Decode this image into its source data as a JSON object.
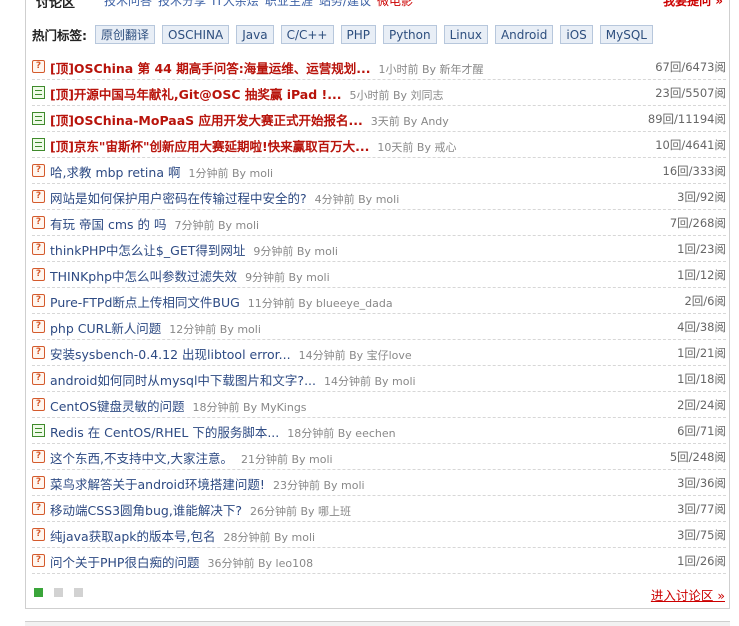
{
  "header": {
    "title": "讨论区",
    "nav": [
      "技术问答",
      "技术分享",
      "IT大杂烩",
      "职业生涯",
      "站务/建议",
      "微电影"
    ],
    "ask_label": "我要提问 »"
  },
  "tags": {
    "label": "热门标签:",
    "items": [
      "原创翻译",
      "OSCHINA",
      "Java",
      "C/C++",
      "PHP",
      "Python",
      "Linux",
      "Android",
      "iOS",
      "MySQL"
    ]
  },
  "posts": [
    {
      "icon": "question-icon",
      "title": "[顶]OSChina 第 44 期高手问答:海量运维、运营规划...",
      "meta": "1小时前 By 新年才醒",
      "count": "67回/6473阅",
      "top": true
    },
    {
      "icon": "document-icon",
      "title": "[顶]开源中国马年献礼,Git@OSC 抽奖赢 iPad !...",
      "meta": "5小时前 By 刘同志",
      "count": "23回/5507阅",
      "top": true
    },
    {
      "icon": "document-icon",
      "title": "[顶]OSChina-MoPaaS 应用开发大赛正式开始报名...",
      "meta": "3天前 By Andy",
      "count": "89回/11194阅",
      "top": true
    },
    {
      "icon": "document-icon",
      "title": "[顶]京东\"宙斯杯\"创新应用大赛延期啦!快来赢取百万大...",
      "meta": "10天前 By 戒心",
      "count": "10回/4641阅",
      "top": true
    },
    {
      "icon": "question-icon",
      "title": "哈,求教 mbp retina 啊",
      "meta": "1分钟前 By moli",
      "count": "16回/333阅",
      "top": false
    },
    {
      "icon": "question-icon",
      "title": "网站是如何保护用户密码在传输过程中安全的?",
      "meta": "4分钟前 By moli",
      "count": "3回/92阅",
      "top": false
    },
    {
      "icon": "question-icon",
      "title": "有玩 帝国 cms 的 吗",
      "meta": "7分钟前 By moli",
      "count": "7回/268阅",
      "top": false
    },
    {
      "icon": "question-icon",
      "title": "thinkPHP中怎么让$_GET得到网址",
      "meta": "9分钟前 By moli",
      "count": "1回/23阅",
      "top": false
    },
    {
      "icon": "question-icon",
      "title": "THINKphp中怎么叫参数过滤失效",
      "meta": "9分钟前 By moli",
      "count": "1回/12阅",
      "top": false
    },
    {
      "icon": "question-icon",
      "title": "Pure-FTPd断点上传相同文件BUG",
      "meta": "11分钟前 By blueeye_dada",
      "count": "2回/6阅",
      "top": false
    },
    {
      "icon": "question-icon",
      "title": "php CURL新人问题",
      "meta": "12分钟前 By moli",
      "count": "4回/38阅",
      "top": false
    },
    {
      "icon": "question-icon",
      "title": "安装sysbench-0.4.12 出现libtool error...",
      "meta": "14分钟前 By 宝仔love",
      "count": "1回/21阅",
      "top": false
    },
    {
      "icon": "question-icon",
      "title": "android如何同时从mysql中下载图片和文字?...",
      "meta": "14分钟前 By moli",
      "count": "1回/18阅",
      "top": false
    },
    {
      "icon": "question-icon",
      "title": "CentOS键盘灵敏的问题",
      "meta": "18分钟前 By MyKings",
      "count": "2回/24阅",
      "top": false
    },
    {
      "icon": "document-icon",
      "title": "Redis 在 CentOS/RHEL 下的服务脚本...",
      "meta": "18分钟前 By eechen",
      "count": "6回/71阅",
      "top": false
    },
    {
      "icon": "question-icon",
      "title": "这个东西,不支持中文,大家注意。",
      "meta": "21分钟前 By moli",
      "count": "5回/248阅",
      "top": false
    },
    {
      "icon": "question-icon",
      "title": "菜鸟求解答关于android环境搭建问题!",
      "meta": "23分钟前 By moli",
      "count": "3回/36阅",
      "top": false
    },
    {
      "icon": "question-icon",
      "title": "移动端CSS3圆角bug,谁能解决下?",
      "meta": "26分钟前 By 哪上班",
      "count": "3回/77阅",
      "top": false
    },
    {
      "icon": "question-icon",
      "title": "纯java获取apk的版本号,包名",
      "meta": "28分钟前 By moli",
      "count": "3回/75阅",
      "top": false
    },
    {
      "icon": "question-icon",
      "title": "问个关于PHP很白痴的问题",
      "meta": "36分钟前 By leo108",
      "count": "1回/26阅",
      "top": false
    }
  ],
  "pager": {
    "pages": 3,
    "active": 1
  },
  "footer": {
    "enter_label": "进入讨论区 »"
  },
  "colors": {
    "top_title": "#b8130b",
    "link": "#2d4a83",
    "pager_active": "#3aa53a"
  }
}
